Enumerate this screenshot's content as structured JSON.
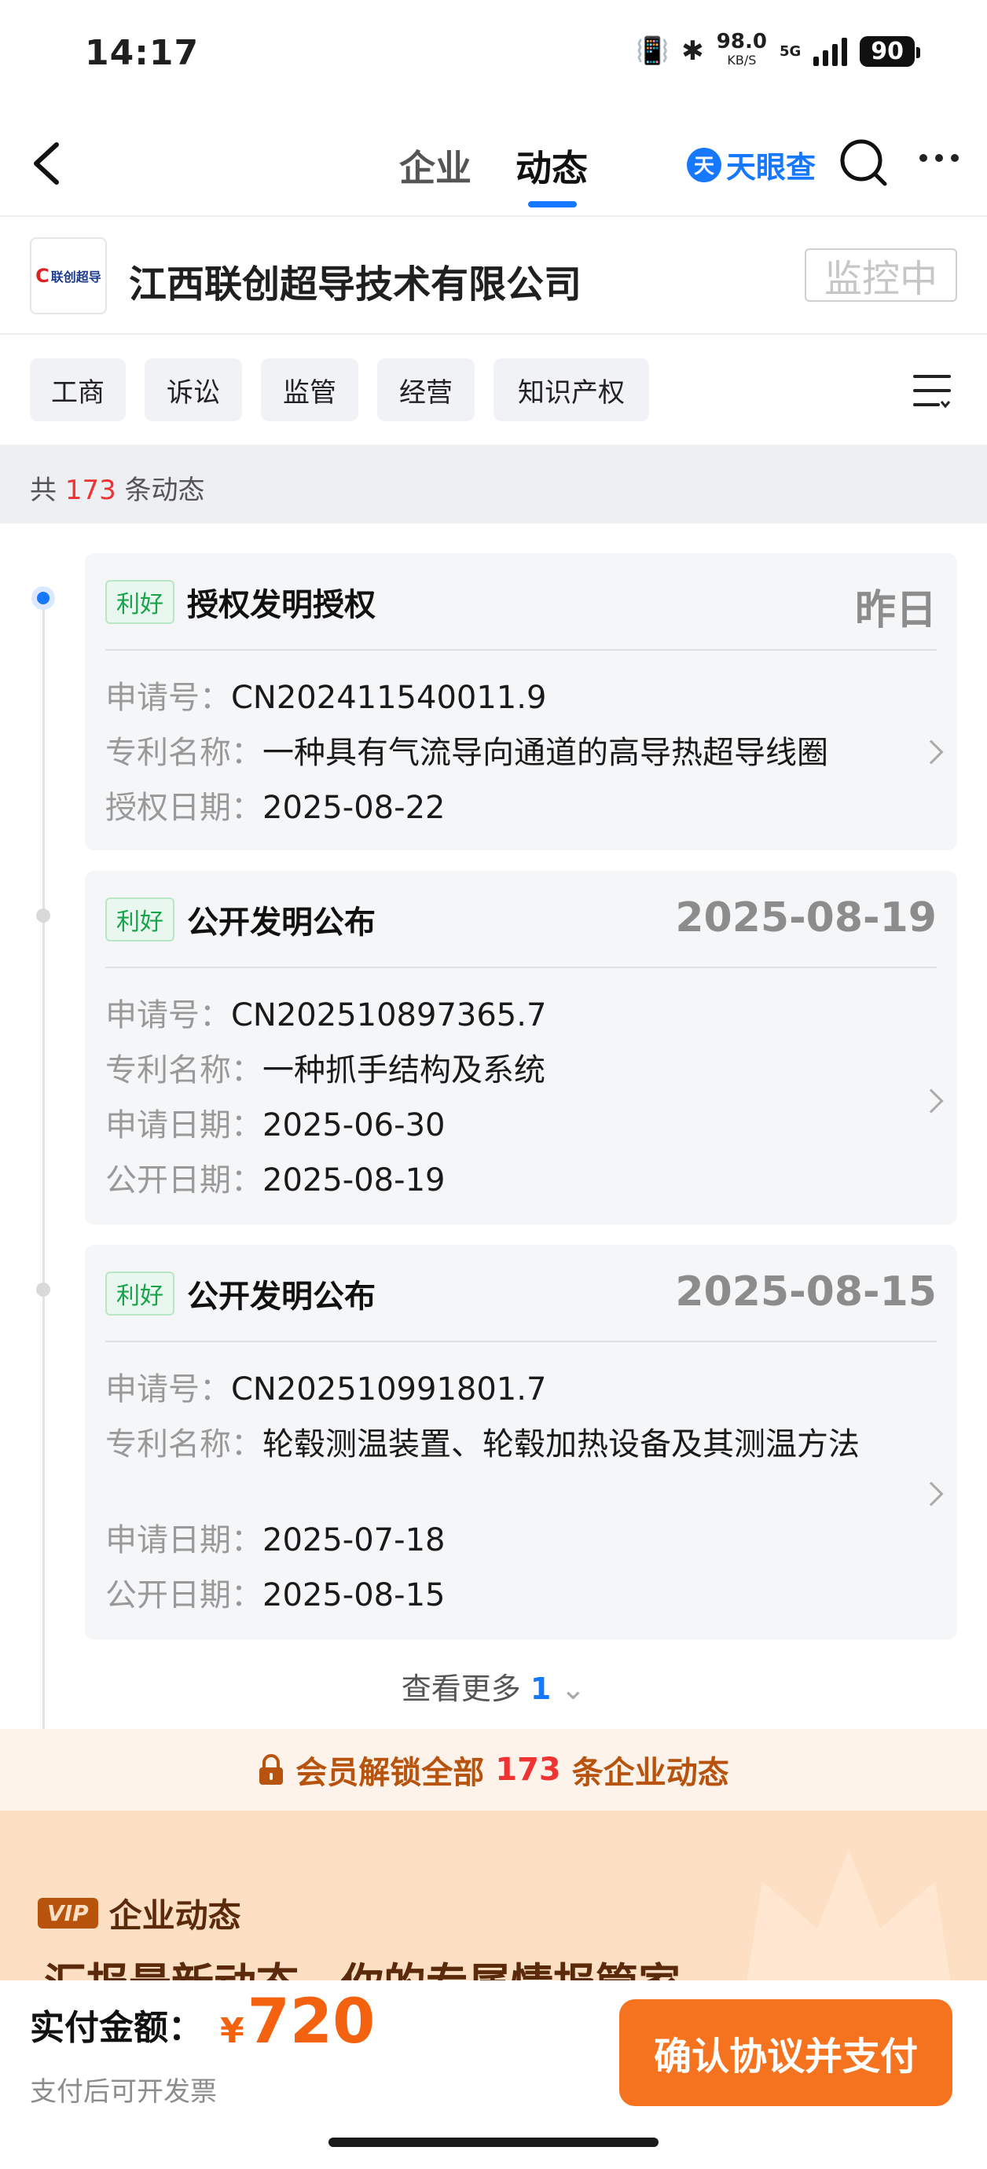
{
  "status_bar": {
    "time": "14:17",
    "net_speed": "98.0",
    "net_unit": "KB/S",
    "network": "5G",
    "battery": "90"
  },
  "nav": {
    "tabs": [
      "企业",
      "动态"
    ],
    "active_tab": "动态",
    "brand": "天眼查"
  },
  "company": {
    "logo_text": "联创超导",
    "name": "江西联创超导技术有限公司",
    "monitor_label": "监控中"
  },
  "filters": [
    "工商",
    "诉讼",
    "监管",
    "经营",
    "知识产权"
  ],
  "summary": {
    "prefix": "共",
    "count": "173",
    "suffix": "条动态"
  },
  "events": [
    {
      "tag": "利好",
      "title": "授权发明授权",
      "date": "昨日",
      "fields": [
        {
          "label": "申请号：",
          "value": "CN202411540011.9"
        },
        {
          "label": "专利名称：",
          "value": "一种具有气流导向通道的高导热超导线圈"
        },
        {
          "label": "授权日期：",
          "value": "2025-08-22"
        }
      ]
    },
    {
      "tag": "利好",
      "title": "公开发明公布",
      "date": "2025-08-19",
      "fields": [
        {
          "label": "申请号：",
          "value": "CN202510897365.7"
        },
        {
          "label": "专利名称：",
          "value": "一种抓手结构及系统"
        },
        {
          "label": "申请日期：",
          "value": "2025-06-30"
        },
        {
          "label": "公开日期：",
          "value": "2025-08-19"
        }
      ]
    },
    {
      "tag": "利好",
      "title": "公开发明公布",
      "date": "2025-08-15",
      "fields": [
        {
          "label": "申请号：",
          "value": "CN202510991801.7"
        },
        {
          "label": "专利名称：",
          "value": "轮毂测温装置、轮毂加热设备及其测温方法"
        },
        {
          "label": "申请日期：",
          "value": "2025-07-18"
        },
        {
          "label": "公开日期：",
          "value": "2025-08-15"
        }
      ]
    }
  ],
  "see_more": {
    "label": "查看更多",
    "count": "1"
  },
  "vip": {
    "unlock_prefix": "会员解锁全部",
    "unlock_count": "173",
    "unlock_suffix": "条企业动态",
    "badge": "VIP",
    "title": "企业动态",
    "slogan": "汇报最新动态，你的专属情报管家"
  },
  "payment": {
    "label": "实付金额：",
    "currency": "¥",
    "amount": "720",
    "invoice_note": "支付后可开发票",
    "button": "确认协议并支付"
  },
  "colors": {
    "accent": "#1677ff",
    "positive_tag": "#16a34a",
    "pay_button": "#f5731f",
    "price": "#f5620f"
  }
}
